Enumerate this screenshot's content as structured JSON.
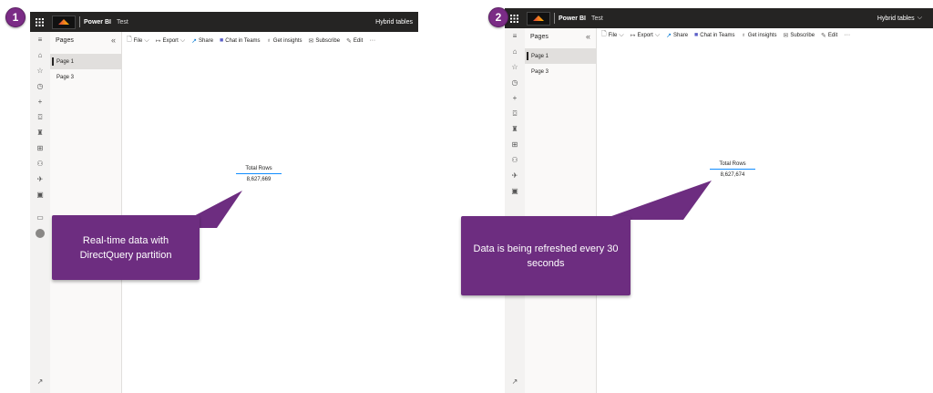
{
  "panels": [
    {
      "step": "1",
      "product": "Power BI",
      "workspace": "Test",
      "report_title": "Hybrid tables",
      "report_chevron": "",
      "pages_title": "Pages",
      "pages": [
        {
          "label": "Page 1",
          "active": true
        },
        {
          "label": "Page 3",
          "active": false
        }
      ],
      "toolbar": [
        "File",
        "Export",
        "Share",
        "Chat in Teams",
        "Get insights",
        "Subscribe",
        "Edit"
      ],
      "card": {
        "title": "Total Rows",
        "value": "8,627,669"
      },
      "callout": "Real-time data with DirectQuery partition"
    },
    {
      "step": "2",
      "product": "Power BI",
      "workspace": "Test",
      "report_title": "Hybrid tables",
      "report_chevron": "⌵",
      "pages_title": "Pages",
      "pages": [
        {
          "label": "Page 1",
          "active": true
        },
        {
          "label": "Page 3",
          "active": false
        }
      ],
      "toolbar": [
        "File",
        "Export",
        "Share",
        "Chat in Teams",
        "Get insights",
        "Subscribe",
        "Edit"
      ],
      "card": {
        "title": "Total Rows",
        "value": "8,627,674"
      },
      "callout": "Data is being refreshed every 30 seconds"
    }
  ],
  "icons": {
    "file": "file-icon",
    "export": "export-icon",
    "share": "share-icon",
    "teams": "teams-icon",
    "insights": "lightbulb-icon",
    "subscribe": "mail-icon",
    "edit": "pencil-icon",
    "more": "more-icon"
  },
  "colors": {
    "callout": "#6d2d80",
    "badge": "#7b2c86",
    "topbar": "#252423",
    "card_underline": "#118dff"
  }
}
